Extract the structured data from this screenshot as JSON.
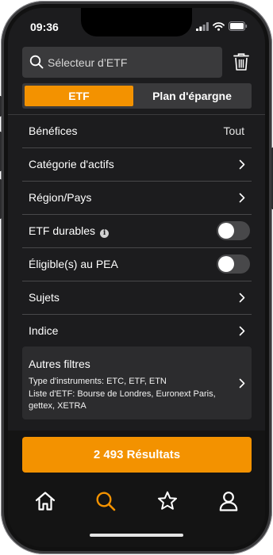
{
  "status_bar": {
    "time": "09:36"
  },
  "search": {
    "placeholder": "Sélecteur d’ETF"
  },
  "segment": {
    "tabs": [
      {
        "label": "ETF",
        "active": true
      },
      {
        "label": "Plan d'épargne",
        "active": false
      }
    ]
  },
  "filters": {
    "benefices": {
      "label": "Bénéfices",
      "value": "Tout"
    },
    "categorie": {
      "label": "Catégorie d'actifs"
    },
    "region": {
      "label": "Région/Pays"
    },
    "durables": {
      "label": "ETF durables",
      "on": false
    },
    "pea": {
      "label": "Éligible(s) au PEA",
      "on": false
    },
    "sujets": {
      "label": "Sujets"
    },
    "indice": {
      "label": "Indice"
    }
  },
  "autres": {
    "title": "Autres filtres",
    "line1": "Type d'instruments: ETC, ETF, ETN",
    "line2": "Liste d'ETF: Bourse de Londres, Euronext Paris, gettex, XETRA"
  },
  "results": {
    "label": "2 493 Résultats"
  },
  "colors": {
    "accent": "#f39200",
    "background": "#1c1c1e",
    "surface": "#2c2c2e"
  },
  "nav": {
    "items": [
      "home-icon",
      "search-icon",
      "star-icon",
      "user-icon"
    ],
    "active": "search-icon"
  }
}
